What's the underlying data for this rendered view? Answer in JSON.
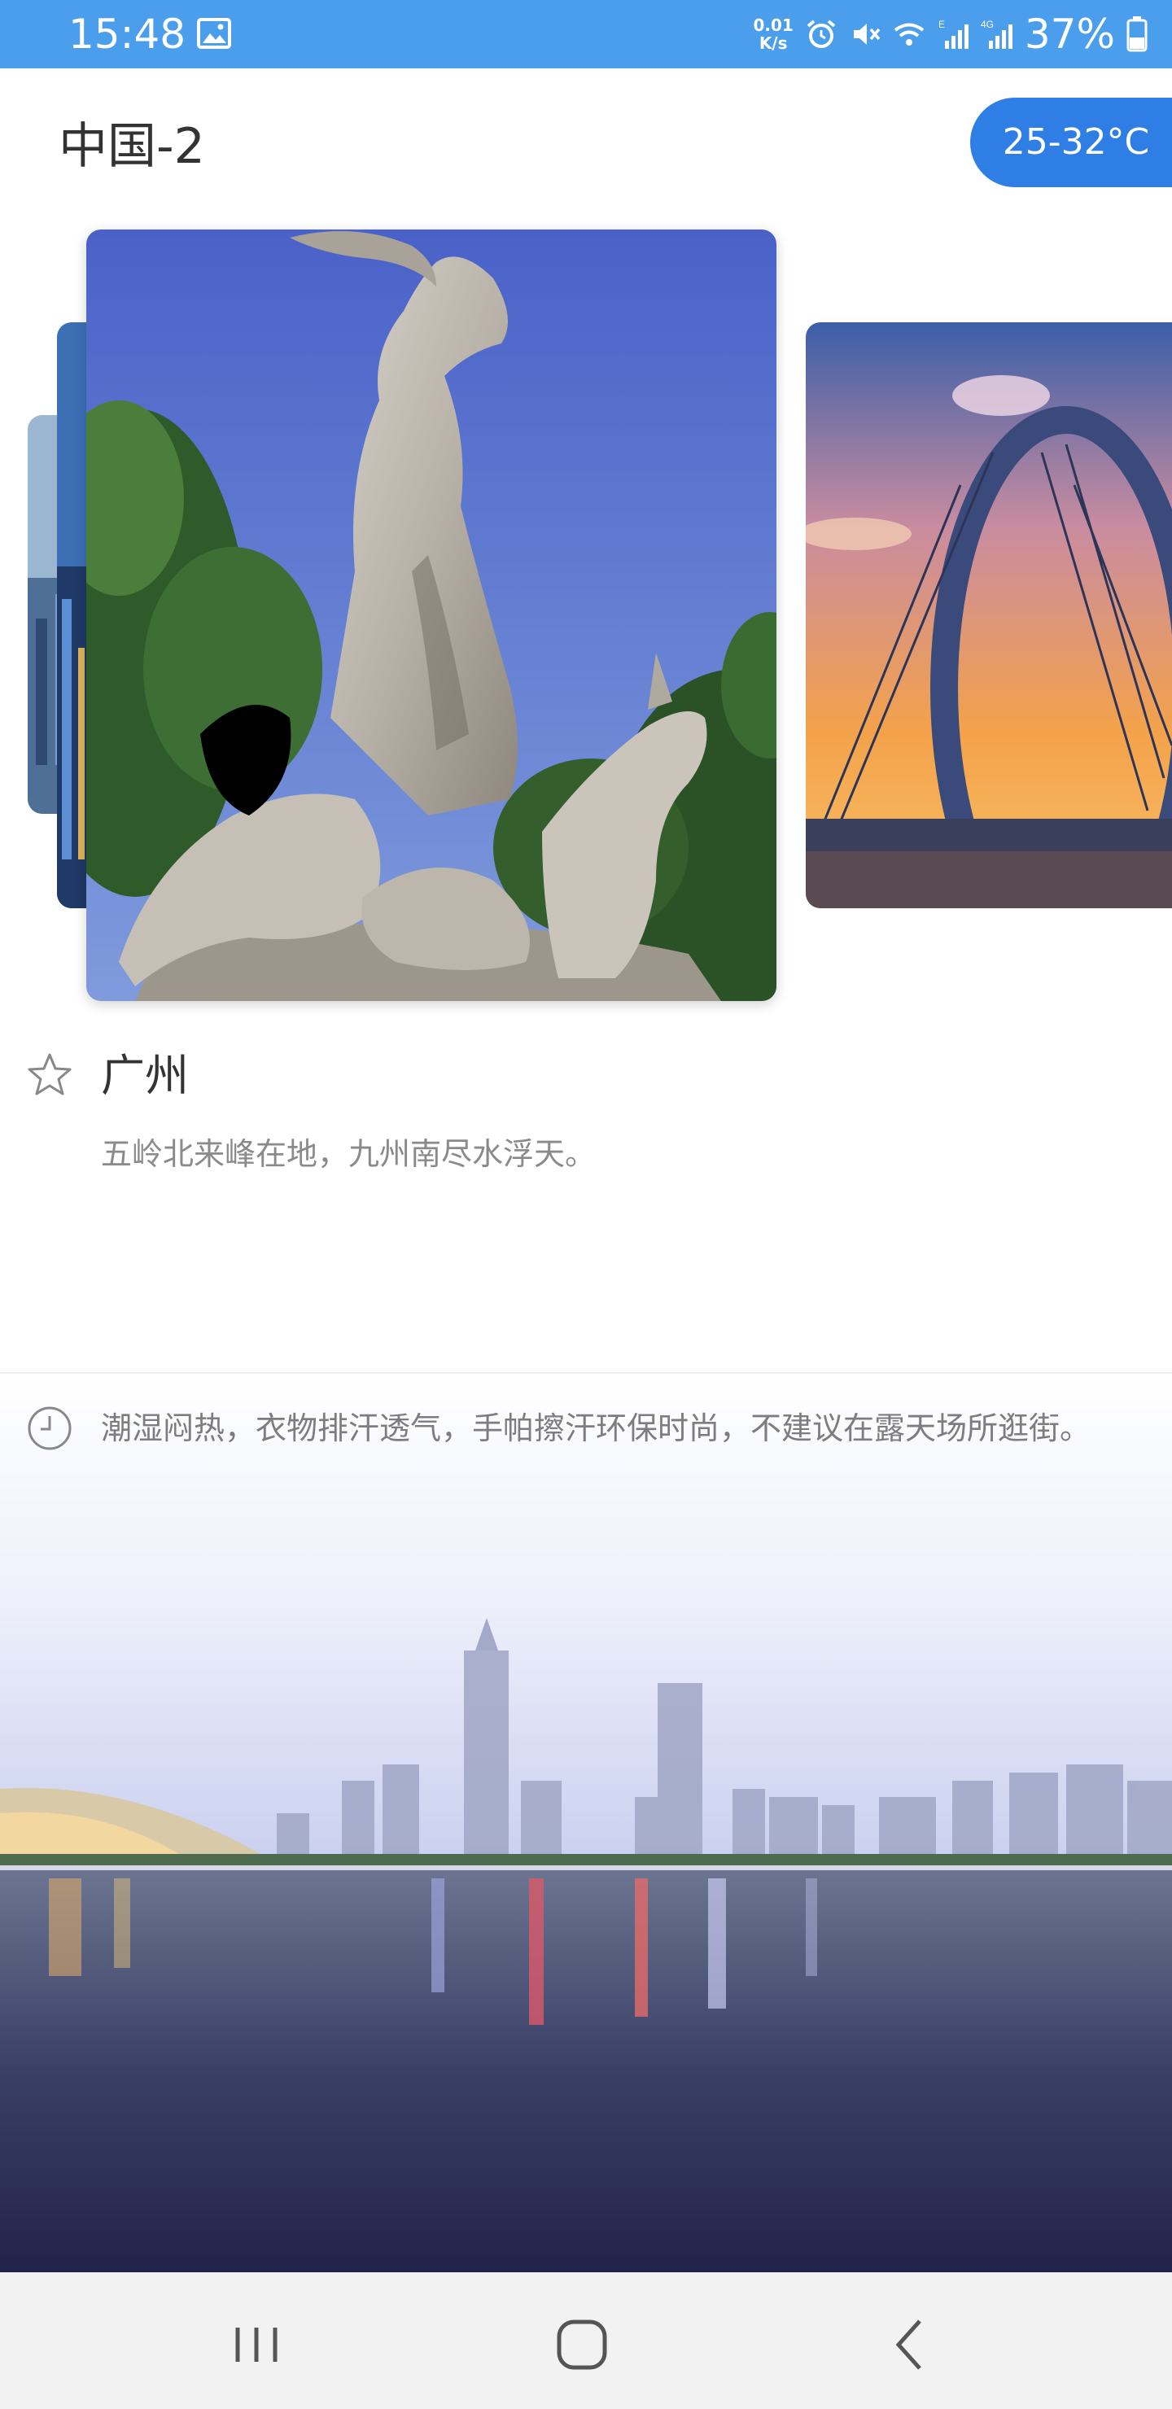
{
  "status_bar": {
    "time": "15:48",
    "net_speed_value": "0.01",
    "net_speed_unit": "K/s",
    "battery": "37%",
    "icons": [
      "image-icon",
      "alarm-icon",
      "mute-icon",
      "wifi-icon",
      "signal-e-icon",
      "signal-4g-icon",
      "battery-icon"
    ]
  },
  "header": {
    "title": "中国-2",
    "temperature": "25-32°C"
  },
  "city": {
    "name": "广州",
    "description": "五岭北来峰在地，九州南尽水浮天。"
  },
  "tip": {
    "text": "潮湿闷热，衣物排汗透气，手帕擦汗环保时尚，不建议在露天场所逛街。"
  },
  "colors": {
    "status_bar": "#4a9eeb",
    "accent": "#2e7ee6",
    "nav_bar": "#f2f2f2"
  }
}
